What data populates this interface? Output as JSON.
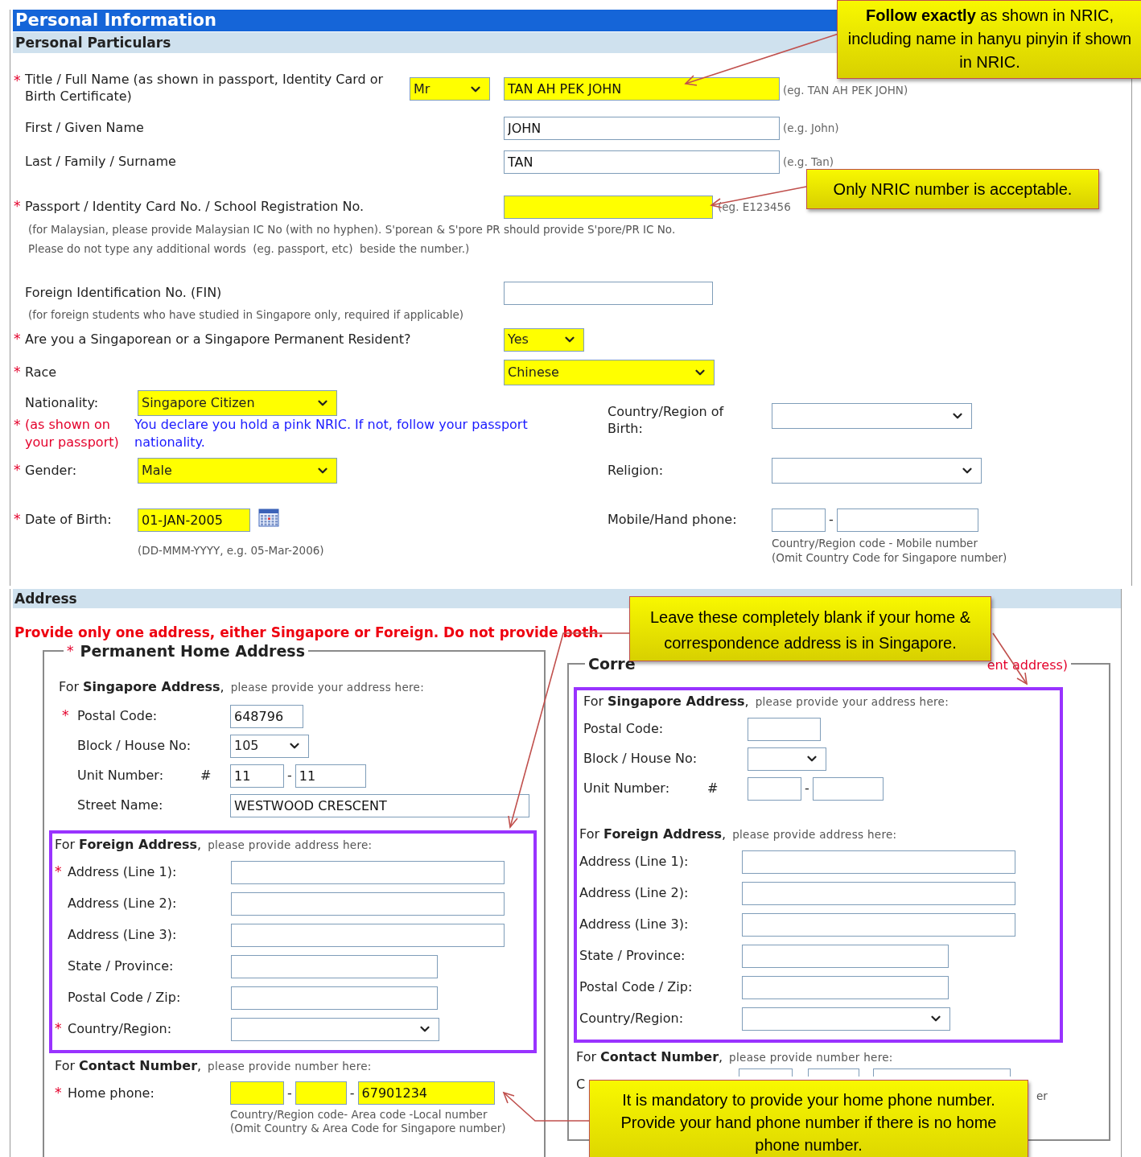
{
  "header": {
    "title": "Personal Information",
    "subtitle": "Personal Particulars"
  },
  "full_name": {
    "mark": "*",
    "label": "Title / Full Name (as shown in passport, Identity Card or Birth Certificate)",
    "title": {
      "value": "Mr",
      "highlighted": true
    },
    "name": {
      "value": "TAN AH PEK JOHN",
      "highlighted": true
    },
    "hint": "(eg. TAN AH PEK JOHN)"
  },
  "first_name": {
    "label": "First / Given Name",
    "value": "JOHN",
    "highlighted": false,
    "hint": "(e.g. John)"
  },
  "last_name": {
    "label": "Last / Family / Surname",
    "value": "TAN",
    "highlighted": false,
    "hint": "(e.g. Tan)"
  },
  "passport": {
    "mark": "*",
    "label": "Passport / Identity Card No. / School Registration No.",
    "highlighted": true,
    "hint": "(eg. E123456",
    "notes": [
      "(for Malaysian, please provide Malaysian IC No (with no hyphen). S'porean & S'pore PR should provide S'pore/PR IC No.",
      "Please do not type any additional words  (eg. passport, etc)  beside the number.)"
    ]
  },
  "fin": {
    "label": "Foreign Identification No. (FIN)",
    "highlighted": false,
    "note": "(for foreign students who have studied in Singapore only, required if applicable)"
  },
  "resident": {
    "mark": "*",
    "label": "Are you a Singaporean or a Singapore Permanent Resident?",
    "value": "Yes",
    "highlighted": true
  },
  "race": {
    "mark": "*",
    "label": "Race",
    "value": "Chinese",
    "highlighted": true
  },
  "nationality": {
    "label": "Nationality:",
    "mark": "*",
    "sublabel": "(as shown on your passport)",
    "value": "Singapore Citizen",
    "highlighted": true,
    "note": "You declare you hold a pink NRIC. If not, follow your passport nationality."
  },
  "gender": {
    "mark": "*",
    "label": "Gender:",
    "value": "Male",
    "highlighted": true
  },
  "birth_date": {
    "mark": "*",
    "label": "Date of Birth:",
    "value": "01-JAN-2005",
    "highlighted": true,
    "hint": "(DD-MMM-YYYY, e.g. 05-Mar-2006)"
  },
  "birth_country": {
    "label": "Country/Region of Birth:"
  },
  "religion": {
    "label": "Religion:"
  },
  "mobile": {
    "label": "Mobile/Hand phone:",
    "separator": "-",
    "hints": [
      "Country/Region code - Mobile number",
      "(Omit Country Code for Singapore number)"
    ]
  },
  "address": {
    "title": "Address",
    "warning": "Provide only one address, either Singapore or Foreign. Do not provide both.",
    "permanent": {
      "mark": "*",
      "legend": "Permanent Home Address",
      "singapore": {
        "heading": "For **Singapore Address**,",
        "prompt": "please provide your address here:",
        "postal": {
          "mark": "*",
          "label": "Postal Code:",
          "value": "648796"
        },
        "block": {
          "label": "Block / House No:",
          "value": "105"
        },
        "unit": {
          "label": "Unit Number:",
          "hash": "#",
          "values": [
            "11",
            "11"
          ],
          "separator": "-"
        },
        "street": {
          "label": "Street Name:",
          "value": "WESTWOOD CRESCENT"
        }
      },
      "foreign": {
        "framed": true,
        "heading": "For **Foreign Address**,",
        "prompt": "please provide address here:",
        "rows": [
          {
            "kind": "line",
            "mark": "*",
            "label": "Address (Line 1):"
          },
          {
            "kind": "line",
            "label": "Address (Line 2):"
          },
          {
            "kind": "line",
            "label": "Address (Line 3):"
          },
          {
            "kind": "text",
            "label": "State / Province:"
          },
          {
            "kind": "text",
            "label": "Postal Code / Zip:"
          },
          {
            "kind": "select",
            "mark": "*",
            "label": "Country/Region:"
          }
        ]
      },
      "contact": {
        "heading": "For **Contact Number**,",
        "prompt": "please provide number here:",
        "mark": "*",
        "label": "Home phone:",
        "local": "67901234",
        "highlighted": true,
        "separator": "-",
        "hint": "Country/Region code- Area code -Local number (Omit Country & Area Code for Singapore number)"
      }
    },
    "correspondence": {
      "legend_start": "Corre",
      "legend_end": "ent address)",
      "singapore": {
        "framed": true,
        "heading": "For **Singapore Address**,",
        "prompt": "please provide your address here:",
        "postal_label": "Postal Code:",
        "block_label": "Block / House No:",
        "unit_label": "Unit Number:",
        "hash": "#",
        "separator": "-"
      },
      "foreign": {
        "heading": "For **Foreign Address**,",
        "prompt": "please provide address here:",
        "rows": [
          {
            "kind": "line",
            "label": "Address (Line 1):"
          },
          {
            "kind": "line",
            "label": "Address (Line 2):"
          },
          {
            "kind": "line",
            "label": "Address (Line 3):"
          },
          {
            "kind": "text",
            "label": "State / Province:"
          },
          {
            "kind": "text",
            "label": "Postal Code / Zip:"
          },
          {
            "kind": "select",
            "label": "Country/Region:"
          }
        ]
      },
      "contact": {
        "heading": "For **Contact Number**,",
        "prompt": "please provide number here:",
        "label": "C",
        "hint_tail": "er"
      }
    }
  },
  "callouts": [
    {
      "text": "**Follow exactly** as shown in NRIC, including name in hanyu pinyin if shown in NRIC."
    },
    {
      "text": "Only NRIC number is acceptable."
    },
    {
      "text": "Leave these completely blank if your home & correspondence address is in Singapore."
    },
    {
      "text": "It is mandatory to provide your home phone number. Provide your hand phone number if there is no home phone number."
    }
  ]
}
